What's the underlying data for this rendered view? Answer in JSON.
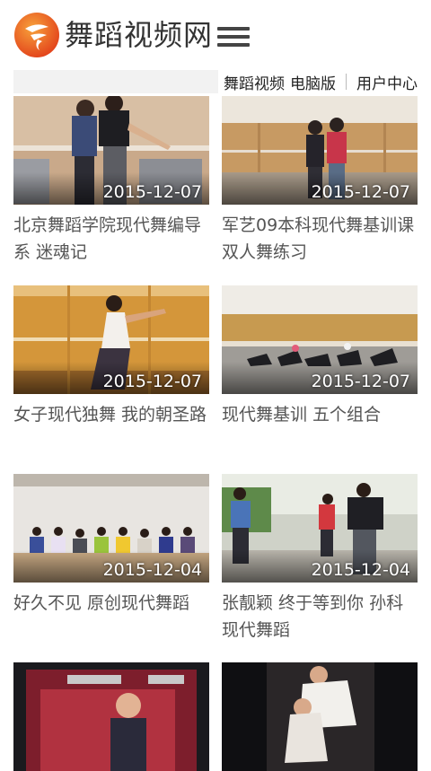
{
  "header": {
    "logo_text": "舞蹈视频网",
    "logo_icon": "dance-logo-icon",
    "menu_icon": "hamburger-menu-icon",
    "brand_color": "#e8531f"
  },
  "subnav": {
    "link1": "舞蹈视频",
    "link2": "电脑版",
    "link3": "用户中心"
  },
  "videos": [
    {
      "date": "2015-12-07",
      "title": "北京舞蹈学院现代舞编导系 迷魂记"
    },
    {
      "date": "2015-12-07",
      "title": "军艺09本科现代舞基训课 双人舞练习"
    },
    {
      "date": "2015-12-07",
      "title": "女子现代独舞 我的朝圣路"
    },
    {
      "date": "2015-12-07",
      "title": "现代舞基训 五个组合"
    },
    {
      "date": "2015-12-04",
      "title": "好久不见 原创现代舞蹈"
    },
    {
      "date": "2015-12-04",
      "title": "张靓颖 终于等到你 孙科现代舞蹈"
    },
    {
      "date": "",
      "title": ""
    },
    {
      "date": "",
      "title": ""
    }
  ]
}
